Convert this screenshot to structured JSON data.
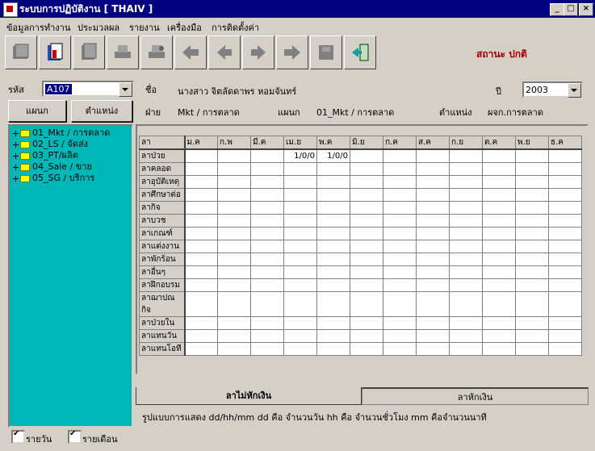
{
  "window": {
    "title": "ระบบการปฏิบัติงาน    [ THAIV ]",
    "min": "_",
    "max": "□",
    "close": "×"
  },
  "menu": [
    "ข้อมูลการทำงาน",
    "ประมวลผล",
    "รายงาน",
    "เครื่องมือ",
    "การติดตั้งค่า"
  ],
  "toolbar_icons": [
    "book-icon",
    "binder-icon",
    "doc-icon",
    "print-icon",
    "print-preview-icon",
    "first-icon",
    "prev-icon",
    "next-icon",
    "last-icon",
    "disk-icon",
    "exit-icon"
  ],
  "status": "สถานะ  ปกติ",
  "form": {
    "code_label": "รหัส",
    "code_value": "A107",
    "name_label": "ชื่อ",
    "name_value": "นางสาว  จิตลัดดาพร  หอมจันทร์",
    "year_label": "ปี",
    "year_value": "2003",
    "dept_label": "ฝ่าย",
    "dept_value": "Mkt / การตลาด",
    "section_label": "แผนก",
    "section_value": "01_Mkt / การตลาด",
    "position_label": "ตำแหน่ง",
    "position_value": "ผจก.การตลาด"
  },
  "buttons": {
    "section": "แผนก",
    "position": "ตำแหน่ง"
  },
  "tree": [
    "01_Mkt / การตลาด",
    "02_LS / จัดส่ง",
    "03_PT/ผลิต",
    "04_Sale / ขาย",
    "05_SG / บริการ"
  ],
  "grid": {
    "corner": "ลา",
    "months": [
      "ม.ค",
      "ก.พ",
      "มี.ค",
      "เม.ย",
      "พ.ค",
      "มิ.ย",
      "ก.ค",
      "ส.ค",
      "ก.ย",
      "ต.ค",
      "พ.ย",
      "ธ.ค"
    ],
    "rows": [
      {
        "label": "ลาป่วย",
        "values": [
          "",
          "",
          "",
          "1/0/0",
          "1/0/0",
          "",
          "",
          "",
          "",
          "",
          "",
          ""
        ]
      },
      {
        "label": "ลาคลอด",
        "values": [
          "",
          "",
          "",
          "",
          "",
          "",
          "",
          "",
          "",
          "",
          "",
          ""
        ]
      },
      {
        "label": "ลาอุบัติเหตุ",
        "values": [
          "",
          "",
          "",
          "",
          "",
          "",
          "",
          "",
          "",
          "",
          "",
          ""
        ]
      },
      {
        "label": "ลาศึกษาต่อ",
        "values": [
          "",
          "",
          "",
          "",
          "",
          "",
          "",
          "",
          "",
          "",
          "",
          ""
        ]
      },
      {
        "label": "ลากิจ",
        "values": [
          "",
          "",
          "",
          "",
          "",
          "",
          "",
          "",
          "",
          "",
          "",
          ""
        ]
      },
      {
        "label": "ลาบวช",
        "values": [
          "",
          "",
          "",
          "",
          "",
          "",
          "",
          "",
          "",
          "",
          "",
          ""
        ]
      },
      {
        "label": "ลาเกณฑ์",
        "values": [
          "",
          "",
          "",
          "",
          "",
          "",
          "",
          "",
          "",
          "",
          "",
          ""
        ]
      },
      {
        "label": "ลาแต่งงาน",
        "values": [
          "",
          "",
          "",
          "",
          "",
          "",
          "",
          "",
          "",
          "",
          "",
          ""
        ]
      },
      {
        "label": "ลาพักร้อน",
        "values": [
          "",
          "",
          "",
          "",
          "",
          "",
          "",
          "",
          "",
          "",
          "",
          ""
        ]
      },
      {
        "label": "ลาอื่นๆ",
        "values": [
          "",
          "",
          "",
          "",
          "",
          "",
          "",
          "",
          "",
          "",
          "",
          ""
        ]
      },
      {
        "label": "ลาฝึกอบรม",
        "values": [
          "",
          "",
          "",
          "",
          "",
          "",
          "",
          "",
          "",
          "",
          "",
          ""
        ]
      },
      {
        "label": "ลาฌาปณกิจ",
        "values": [
          "",
          "",
          "",
          "",
          "",
          "",
          "",
          "",
          "",
          "",
          "",
          ""
        ]
      },
      {
        "label": "ลาป่วยใน",
        "values": [
          "",
          "",
          "",
          "",
          "",
          "",
          "",
          "",
          "",
          "",
          "",
          ""
        ]
      },
      {
        "label": "ลาแทนวัน",
        "values": [
          "",
          "",
          "",
          "",
          "",
          "",
          "",
          "",
          "",
          "",
          "",
          ""
        ]
      },
      {
        "label": "ลาแทนโอที",
        "values": [
          "",
          "",
          "",
          "",
          "",
          "",
          "",
          "",
          "",
          "",
          "",
          ""
        ]
      }
    ]
  },
  "tabs": {
    "active": "ลาไม่หักเงิน",
    "inactive": "ลาหักเงิน"
  },
  "format_note": "รูปแบบการแสดง   dd/hh/mm   dd คือ จำนวนวัน  hh คือ จำนวนชั่วโมง  mm คือจำนวนนาที",
  "checkboxes": {
    "daily": "รายวัน",
    "monthly": "รายเดือน"
  }
}
